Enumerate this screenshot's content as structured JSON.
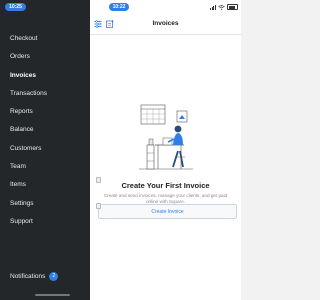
{
  "status_bar": {
    "left_time": "10:25",
    "main_time": "10:22"
  },
  "sidebar": {
    "items": [
      {
        "label": "Checkout",
        "active": false
      },
      {
        "label": "Orders",
        "active": false
      },
      {
        "label": "Invoices",
        "active": true
      },
      {
        "label": "Transactions",
        "active": false
      },
      {
        "label": "Reports",
        "active": false
      },
      {
        "label": "Balance",
        "active": false
      },
      {
        "label": "Customers",
        "active": false
      },
      {
        "label": "Team",
        "active": false
      },
      {
        "label": "Items",
        "active": false
      },
      {
        "label": "Settings",
        "active": false
      },
      {
        "label": "Support",
        "active": false
      }
    ],
    "notifications": {
      "label": "Notifications",
      "count": "2"
    }
  },
  "header": {
    "title": "Invoices"
  },
  "empty_state": {
    "title": "Create Your First Invoice",
    "description": "Create and send invoices, manage your clients, and get paid online with Square.",
    "button_label": "Create Invoice"
  },
  "colors": {
    "sidebar_bg": "#24272a",
    "accent": "#2f7fe7",
    "main_bg": "#ffffff"
  }
}
